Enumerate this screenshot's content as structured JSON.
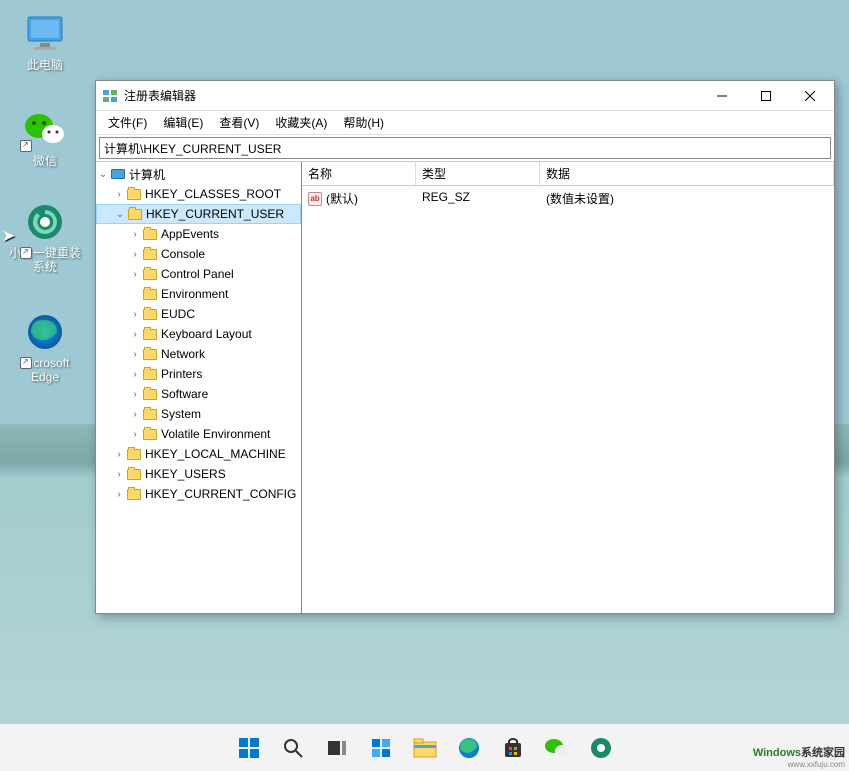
{
  "desktop_icons": [
    {
      "name": "此电脑",
      "kind": "pc"
    },
    {
      "name": "微信",
      "kind": "wechat",
      "shortcut": true
    },
    {
      "name": "小白一键重装系统",
      "kind": "xiaobai",
      "shortcut": true
    },
    {
      "name": "Microsoft Edge",
      "kind": "edge",
      "shortcut": true
    }
  ],
  "window": {
    "title": "注册表编辑器",
    "menu": {
      "file": "文件(F)",
      "edit": "编辑(E)",
      "view": "查看(V)",
      "favorites": "收藏夹(A)",
      "help": "帮助(H)"
    },
    "address": "计算机\\HKEY_CURRENT_USER",
    "tree": {
      "root": "计算机",
      "hives": [
        {
          "label": "HKEY_CLASSES_ROOT",
          "expanded": false,
          "depth": 1
        },
        {
          "label": "HKEY_CURRENT_USER",
          "expanded": true,
          "selected": true,
          "depth": 1
        },
        {
          "label": "AppEvents",
          "expanded": false,
          "depth": 2,
          "hasChildren": true
        },
        {
          "label": "Console",
          "expanded": false,
          "depth": 2,
          "hasChildren": true
        },
        {
          "label": "Control Panel",
          "expanded": false,
          "depth": 2,
          "hasChildren": true
        },
        {
          "label": "Environment",
          "expanded": false,
          "depth": 2,
          "hasChildren": false
        },
        {
          "label": "EUDC",
          "expanded": false,
          "depth": 2,
          "hasChildren": true
        },
        {
          "label": "Keyboard Layout",
          "expanded": false,
          "depth": 2,
          "hasChildren": true
        },
        {
          "label": "Network",
          "expanded": false,
          "depth": 2,
          "hasChildren": true
        },
        {
          "label": "Printers",
          "expanded": false,
          "depth": 2,
          "hasChildren": true
        },
        {
          "label": "Software",
          "expanded": false,
          "depth": 2,
          "hasChildren": true
        },
        {
          "label": "System",
          "expanded": false,
          "depth": 2,
          "hasChildren": true
        },
        {
          "label": "Volatile Environment",
          "expanded": false,
          "depth": 2,
          "hasChildren": true
        },
        {
          "label": "HKEY_LOCAL_MACHINE",
          "expanded": false,
          "depth": 1
        },
        {
          "label": "HKEY_USERS",
          "expanded": false,
          "depth": 1
        },
        {
          "label": "HKEY_CURRENT_CONFIG",
          "expanded": false,
          "depth": 1
        }
      ]
    },
    "values": {
      "headers": {
        "name": "名称",
        "type": "类型",
        "data": "数据"
      },
      "rows": [
        {
          "name": "(默认)",
          "type": "REG_SZ",
          "data": "(数值未设置)"
        }
      ]
    }
  },
  "watermark": {
    "brand_w": "W",
    "brand_rest": "indows",
    "suffix": "系统家园",
    "sub": "www.xxfuju.com"
  }
}
